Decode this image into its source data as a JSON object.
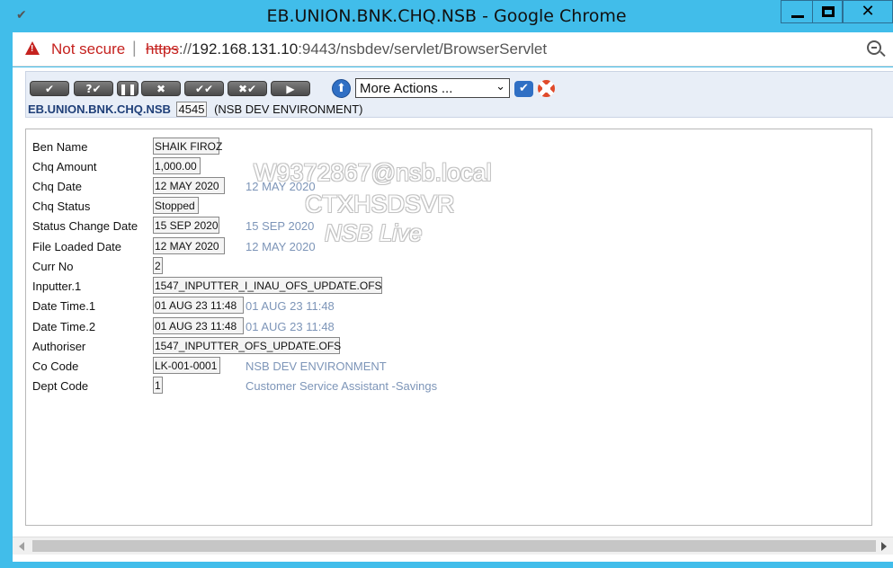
{
  "window": {
    "title": "EB.UNION.BNK.CHQ.NSB - Google Chrome",
    "minimize_label": "",
    "close_label": "✕"
  },
  "address": {
    "security": "Not secure",
    "scheme": "https",
    "host": "192.168.131.10",
    "rest": ":9443/nsbdev/servlet/BrowserServlet"
  },
  "toolbar": {
    "buttons": [
      "✔",
      "?✔",
      "❚❚",
      "✖",
      "✔✔",
      "✖✔",
      "▶"
    ],
    "more_actions": "More Actions ...",
    "app_name": "EB.UNION.BNK.CHQ.NSB",
    "record_id": "4545",
    "environment": "(NSB DEV ENVIRONMENT)"
  },
  "watermark": {
    "user": "W9372867@nsb.local",
    "server": "CTXHSDSVR",
    "env": "NSB Live"
  },
  "fields": [
    {
      "label": "Ben Name",
      "value": "SHAIK FIROZ",
      "enrichment": ""
    },
    {
      "label": "Chq Amount",
      "value": "1,000.00",
      "enrichment": ""
    },
    {
      "label": "Chq Date",
      "value": "12 MAY 2020",
      "enrichment": "12 MAY 2020"
    },
    {
      "label": "Chq Status",
      "value": "Stopped",
      "enrichment": ""
    },
    {
      "label": "Status Change Date",
      "value": "15 SEP 2020",
      "enrichment": "15 SEP 2020"
    },
    {
      "label": "File Loaded Date",
      "value": "12 MAY 2020",
      "enrichment": "12 MAY 2020"
    },
    {
      "label": "Curr No",
      "value": "2",
      "enrichment": ""
    },
    {
      "label": "Inputter.1",
      "value": "1547_INPUTTER_I_INAU_OFS_UPDATE.OFS",
      "enrichment": ""
    },
    {
      "label": "Date Time.1",
      "value": "01 AUG 23 11:48",
      "enrichment": "01 AUG 23 11:48"
    },
    {
      "label": "Date Time.2",
      "value": "01 AUG 23 11:48",
      "enrichment": "01 AUG 23 11:48"
    },
    {
      "label": "Authoriser",
      "value": "1547_INPUTTER_OFS_UPDATE.OFS",
      "enrichment": ""
    },
    {
      "label": "Co Code",
      "value": "LK-001-0001",
      "enrichment": "NSB DEV ENVIRONMENT"
    },
    {
      "label": "Dept Code",
      "value": "1",
      "enrichment": "Customer Service Assistant -Savings"
    }
  ]
}
